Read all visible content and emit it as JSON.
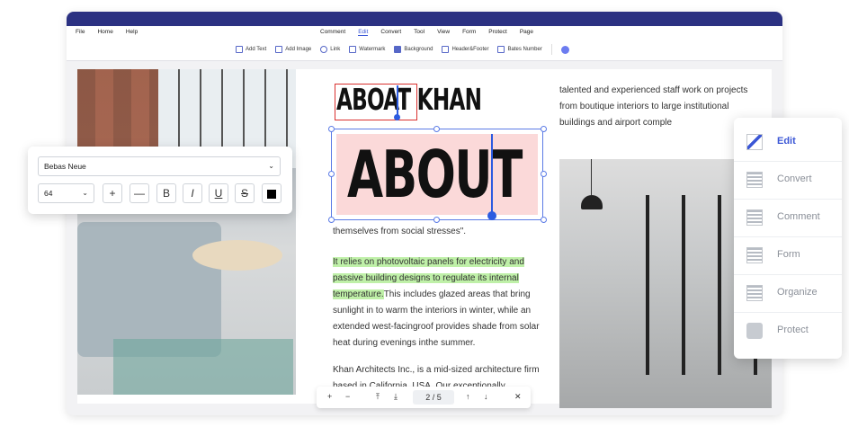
{
  "menubar": {
    "left": [
      "File",
      "Home",
      "Help"
    ],
    "center": [
      "Comment",
      "Edit",
      "Convert",
      "Tool",
      "View",
      "Form",
      "Protect",
      "Page"
    ],
    "active": "Edit"
  },
  "toolbar": {
    "items": [
      "Add Text",
      "Add Image",
      "Link",
      "Watermark",
      "Background",
      "Header&Footer",
      "Bates Number"
    ]
  },
  "document": {
    "headline": "ABOAT KHAN",
    "about": "ABOUT",
    "line1": "themselves from social stresses\".",
    "para_highlight": "It relies on photovoltaic panels for electricity and passive building designs to regulate its internal temperature.",
    "para_rest": "This includes glazed areas that bring sunlight in to warm the interiors in winter, while an extended west-facingroof provides shade from solar heat during evenings inthe summer.",
    "para2": "Khan Architects Inc., is a mid-sized architecture firm based in California, USA. Our exceptionally",
    "right_text": "talented and experienced staff work on projects from boutique interiors to large institutional buildings and airport comple"
  },
  "pager": {
    "zoom_in": "+",
    "zoom_out": "−",
    "first": "⤒",
    "down": "⤓",
    "page": "2 / 5",
    "up": "↑",
    "next": "↓",
    "close": "✕"
  },
  "font_panel": {
    "font": "Bebas Neue",
    "size": "64",
    "buttons": [
      "+",
      "—",
      "B",
      "I",
      "U",
      "S"
    ],
    "color": "#000000"
  },
  "side_panel": {
    "items": [
      {
        "label": "Edit",
        "icon": "edit-icon"
      },
      {
        "label": "Convert",
        "icon": "convert-icon"
      },
      {
        "label": "Comment",
        "icon": "comment-icon"
      },
      {
        "label": "Form",
        "icon": "form-icon"
      },
      {
        "label": "Organize",
        "icon": "organize-icon"
      },
      {
        "label": "Protect",
        "icon": "protect-icon"
      }
    ],
    "active": "Edit"
  },
  "colors": {
    "topbar": "#2b3182",
    "accent": "#3b57d6",
    "highlight": "#bff0a8",
    "selection_bg": "#fbd9d9"
  }
}
